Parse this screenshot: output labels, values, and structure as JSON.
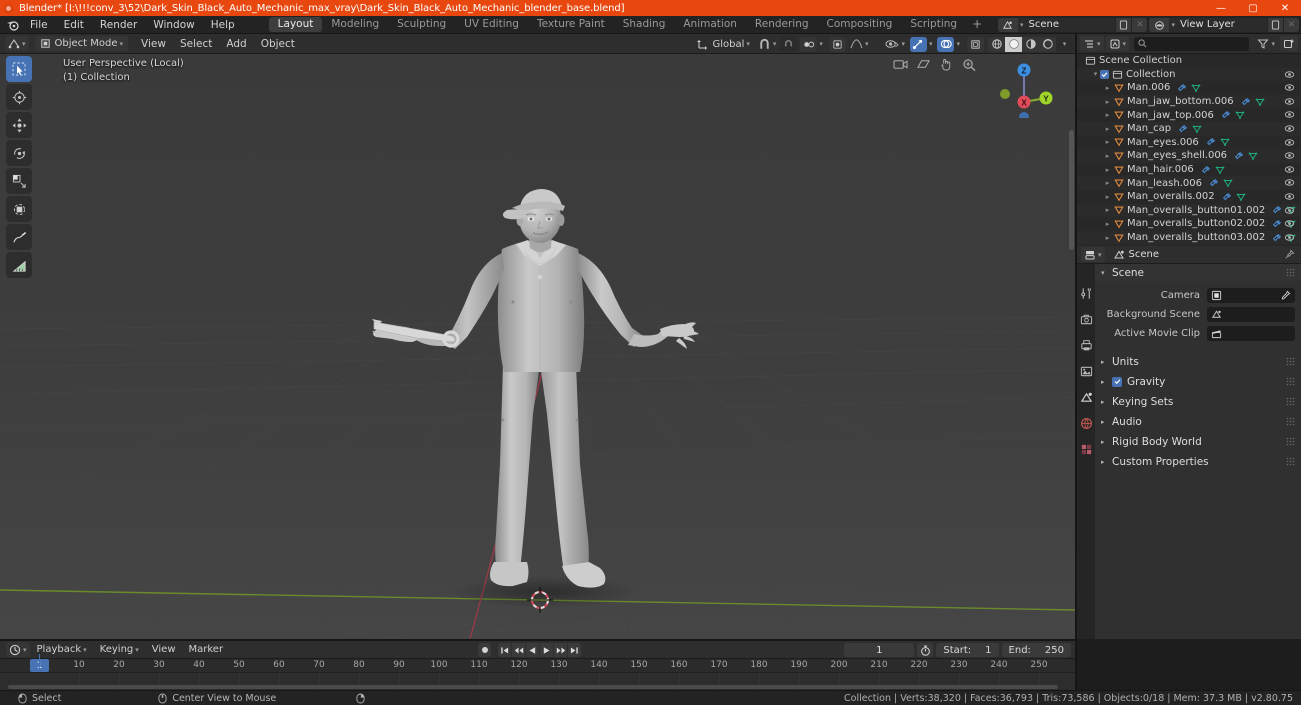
{
  "window": {
    "title": "Blender* [I:\\!!!conv_3\\52\\Dark_Skin_Black_Auto_Mechanic_max_vray\\Dark_Skin_Black_Auto_Mechanic_blender_base.blend]",
    "minimize": "—",
    "maximize": "▢",
    "close": "✕"
  },
  "topbar": {
    "menus": [
      "File",
      "Edit",
      "Render",
      "Window",
      "Help"
    ],
    "workspaces": [
      {
        "label": "Layout",
        "active": true
      },
      {
        "label": "Modeling",
        "active": false
      },
      {
        "label": "Sculpting",
        "active": false
      },
      {
        "label": "UV Editing",
        "active": false
      },
      {
        "label": "Texture Paint",
        "active": false
      },
      {
        "label": "Shading",
        "active": false
      },
      {
        "label": "Animation",
        "active": false
      },
      {
        "label": "Rendering",
        "active": false
      },
      {
        "label": "Compositing",
        "active": false
      },
      {
        "label": "Scripting",
        "active": false
      }
    ],
    "add_workspace": "+",
    "scene": {
      "name": "Scene",
      "icon": "scene-icon",
      "new_label": "",
      "unlink_label": "✕"
    },
    "view_layer": {
      "name": "View Layer",
      "icon": "view-layer-icon",
      "new_label": "",
      "unlink_label": "✕"
    }
  },
  "viewport": {
    "editor_type_icon": "editor-type-3dview-icon",
    "mode": "Object Mode",
    "menus": [
      "View",
      "Select",
      "Add",
      "Object"
    ],
    "transform_orientation": "Global",
    "snap_icon": "magnet-icon",
    "proportional_icon": "proportional-editing-icon",
    "falloff_icon": "smooth-falloff-icon",
    "overlay_text_line1": "User Perspective (Local)",
    "overlay_text_line2": "(1) Collection",
    "tools": [
      {
        "name": "select-box-tool",
        "active": true
      },
      {
        "name": "cursor-tool",
        "active": false
      },
      {
        "name": "move-tool",
        "active": false
      },
      {
        "name": "rotate-tool",
        "active": false
      },
      {
        "name": "scale-tool",
        "active": false
      },
      {
        "name": "transform-tool",
        "active": false
      },
      {
        "name": "annotate-tool",
        "active": false
      },
      {
        "name": "measure-tool",
        "active": false
      }
    ],
    "gizmo_axes": [
      {
        "label": "X",
        "color": "#e04c5a"
      },
      {
        "label": "Y",
        "color": "#9fd42a"
      },
      {
        "label": "Z",
        "color": "#3b8ee0"
      }
    ],
    "nav_buttons": [
      "zoom-icon",
      "move-view-icon",
      "camera-view-icon",
      "toggle-ortho-icon"
    ],
    "shading_modes": [
      "wireframe-shading",
      "solid-shading",
      "material-preview-shading",
      "rendered-shading"
    ]
  },
  "outliner": {
    "display_mode_icon": "outliner-display-mode-icon",
    "filter_id_icon": "filter-id-icon",
    "search_placeholder": "",
    "search_icon": "search-icon",
    "filter_icon": "filter-funnel-icon",
    "new_collection_icon": "new-collection-icon",
    "rows": [
      {
        "label": "Scene Collection",
        "indent": 0,
        "icon": "scene-collection-icon",
        "disclosure": "",
        "checkbox": false,
        "mods": [],
        "eye": false
      },
      {
        "label": "Collection",
        "indent": 1,
        "icon": "collection-icon",
        "disclosure": "▾",
        "checkbox": true,
        "mods": [],
        "eye": true
      },
      {
        "label": "Man.006",
        "indent": 2,
        "icon": "mesh-icon",
        "disclosure": "▸",
        "checkbox": false,
        "mods": [
          "modifier-icon",
          "mesh-data-icon"
        ],
        "eye": true
      },
      {
        "label": "Man_jaw_bottom.006",
        "indent": 2,
        "icon": "mesh-icon",
        "disclosure": "▸",
        "checkbox": false,
        "mods": [
          "modifier-icon",
          "mesh-data-icon"
        ],
        "eye": true
      },
      {
        "label": "Man_jaw_top.006",
        "indent": 2,
        "icon": "mesh-icon",
        "disclosure": "▸",
        "checkbox": false,
        "mods": [
          "modifier-icon",
          "mesh-data-icon"
        ],
        "eye": true
      },
      {
        "label": "Man_cap",
        "indent": 2,
        "icon": "mesh-icon",
        "disclosure": "▸",
        "checkbox": false,
        "mods": [
          "modifier-icon",
          "mesh-data-icon"
        ],
        "eye": true
      },
      {
        "label": "Man_eyes.006",
        "indent": 2,
        "icon": "mesh-icon",
        "disclosure": "▸",
        "checkbox": false,
        "mods": [
          "modifier-icon",
          "mesh-data-icon"
        ],
        "eye": true
      },
      {
        "label": "Man_eyes_shell.006",
        "indent": 2,
        "icon": "mesh-icon",
        "disclosure": "▸",
        "checkbox": false,
        "mods": [
          "modifier-icon",
          "mesh-data-icon"
        ],
        "eye": true
      },
      {
        "label": "Man_hair.006",
        "indent": 2,
        "icon": "mesh-icon",
        "disclosure": "▸",
        "checkbox": false,
        "mods": [
          "modifier-icon",
          "mesh-data-icon"
        ],
        "eye": true
      },
      {
        "label": "Man_leash.006",
        "indent": 2,
        "icon": "mesh-icon",
        "disclosure": "▸",
        "checkbox": false,
        "mods": [
          "modifier-icon",
          "mesh-data-icon"
        ],
        "eye": true
      },
      {
        "label": "Man_overalls.002",
        "indent": 2,
        "icon": "mesh-icon",
        "disclosure": "▸",
        "checkbox": false,
        "mods": [
          "modifier-icon",
          "mesh-data-icon"
        ],
        "eye": true
      },
      {
        "label": "Man_overalls_button01.002",
        "indent": 2,
        "icon": "mesh-icon",
        "disclosure": "▸",
        "checkbox": false,
        "mods": [
          "modifier-icon",
          "mesh-data-icon"
        ],
        "eye": true
      },
      {
        "label": "Man_overalls_button02.002",
        "indent": 2,
        "icon": "mesh-icon",
        "disclosure": "▸",
        "checkbox": false,
        "mods": [
          "modifier-icon",
          "mesh-data-icon"
        ],
        "eye": true
      },
      {
        "label": "Man_overalls_button03.002",
        "indent": 2,
        "icon": "mesh-icon",
        "disclosure": "▸",
        "checkbox": false,
        "mods": [
          "modifier-icon",
          "mesh-data-icon"
        ],
        "eye": true
      }
    ]
  },
  "properties": {
    "editor_icon": "properties-editor-icon",
    "breadcrumb_icon": "scene-icon",
    "breadcrumb": "Scene",
    "pin_icon": "pin-icon",
    "tabs": [
      {
        "name": "tool-tab",
        "icon": "tool-icon"
      },
      {
        "name": "render-tab",
        "icon": "render-camera-icon"
      },
      {
        "name": "output-tab",
        "icon": "output-printer-icon"
      },
      {
        "name": "view-layer-tab",
        "icon": "view-layer-images-icon"
      },
      {
        "name": "scene-tab",
        "icon": "scene-cone-icon",
        "active": true
      },
      {
        "name": "world-tab",
        "icon": "world-globe-icon"
      },
      {
        "name": "texture-tab",
        "icon": "texture-checker-icon"
      }
    ],
    "panel_title": "Scene",
    "fields": [
      {
        "label": "Camera",
        "icon": "camera-icon",
        "value": ""
      },
      {
        "label": "Background Scene",
        "icon": "scene-icon",
        "value": ""
      },
      {
        "label": "Active Movie Clip",
        "icon": "clapperboard-icon",
        "value": ""
      }
    ],
    "panels": [
      {
        "label": "Units",
        "checkbox": false
      },
      {
        "label": "Gravity",
        "checkbox": true
      },
      {
        "label": "Keying Sets",
        "checkbox": false
      },
      {
        "label": "Audio",
        "checkbox": false
      },
      {
        "label": "Rigid Body World",
        "checkbox": false
      },
      {
        "label": "Custom Properties",
        "checkbox": false
      }
    ]
  },
  "timeline": {
    "editor_icon": "timeline-editor-icon",
    "menus": [
      "Playback",
      "Keying",
      "View",
      "Marker"
    ],
    "playback_buttons": [
      "record-icon",
      "jump-start-icon",
      "prev-keyframe-icon",
      "play-reverse-icon",
      "play-icon",
      "next-keyframe-icon",
      "jump-end-icon"
    ],
    "current_frame": "1",
    "autokey_icon": "stopwatch-icon",
    "start_label": "Start:",
    "start_value": "1",
    "end_label": "End:",
    "end_value": "250",
    "playhead_label": "1",
    "ticks": [
      10,
      20,
      30,
      40,
      50,
      60,
      70,
      80,
      90,
      100,
      110,
      120,
      130,
      140,
      150,
      160,
      170,
      180,
      190,
      200,
      210,
      220,
      230,
      240,
      250
    ]
  },
  "statusbar": {
    "items": [
      {
        "icon": "mouse-left-icon",
        "label": "Select"
      },
      {
        "icon": "mouse-middle-icon",
        "label": "Center View to Mouse"
      },
      {
        "icon": "mouse-right-icon",
        "label": ""
      }
    ],
    "stats": "Collection | Verts:38,320 | Faces:36,793 | Tris:73,586 | Objects:0/18 | Mem: 37.3 MB | v2.80.75"
  },
  "colors": {
    "accent": "#4772b3",
    "title_bar": "#e8470f",
    "mesh_orange": "#e08a3c",
    "data_green": "#1fa87a",
    "modifier_blue": "#4a90d9"
  }
}
